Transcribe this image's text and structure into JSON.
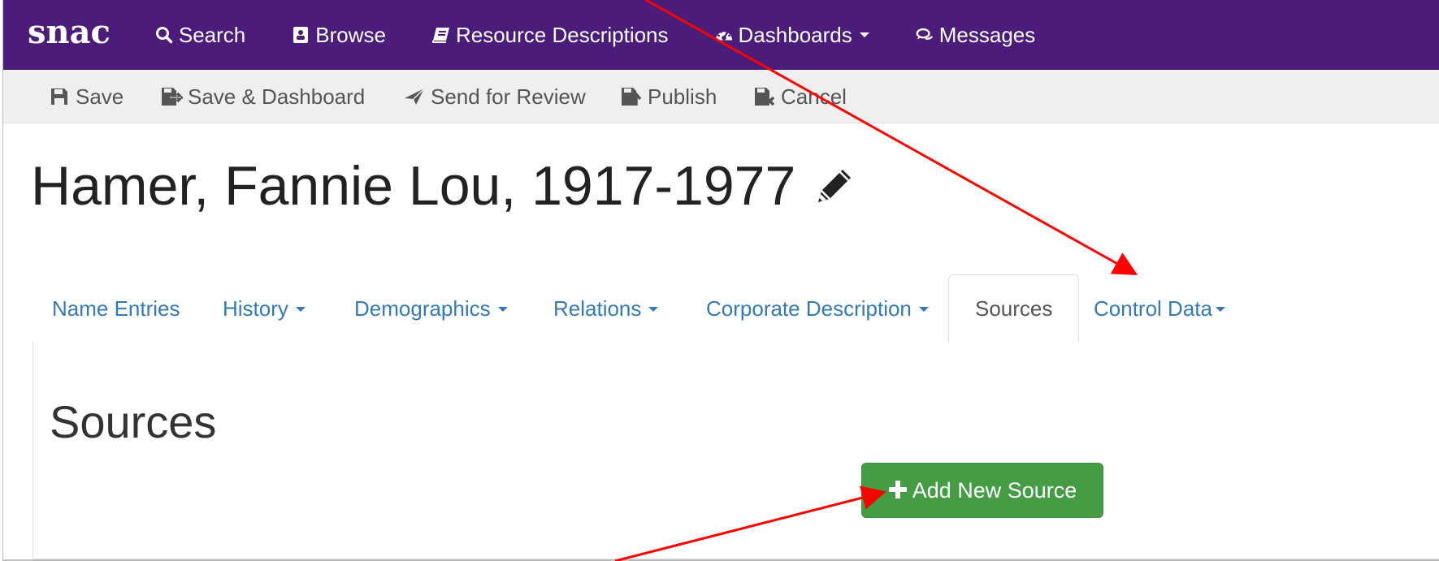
{
  "nav": {
    "brand": "snac",
    "items": [
      {
        "label": "Search",
        "icon": "search-icon"
      },
      {
        "label": "Browse",
        "icon": "browse-icon"
      },
      {
        "label": "Resource Descriptions",
        "icon": "book-icon"
      },
      {
        "label": "Dashboards",
        "icon": "dashboard-icon",
        "dropdown": true
      },
      {
        "label": "Messages",
        "icon": "messages-icon"
      }
    ]
  },
  "toolbar": {
    "save": "Save",
    "save_dashboard": "Save & Dashboard",
    "send_review": "Send for Review",
    "publish": "Publish",
    "cancel": "Cancel"
  },
  "page": {
    "title": "Hamer, Fannie Lou, 1917-1977"
  },
  "tabs": [
    {
      "label": "Name Entries"
    },
    {
      "label": "History",
      "dropdown": true
    },
    {
      "label": "Demographics",
      "dropdown": true
    },
    {
      "label": "Relations",
      "dropdown": true
    },
    {
      "label": "Corporate Description",
      "dropdown": true
    },
    {
      "label": "Sources",
      "active": true
    },
    {
      "label": "Control Data",
      "dropdown": true
    }
  ],
  "section": {
    "title": "Sources",
    "add_button": "Add New Source"
  },
  "colors": {
    "navbar": "#4b1c7a",
    "toolbar": "#efefef",
    "link": "#337ab7",
    "success": "#449d44",
    "annotation": "#ff0000"
  }
}
